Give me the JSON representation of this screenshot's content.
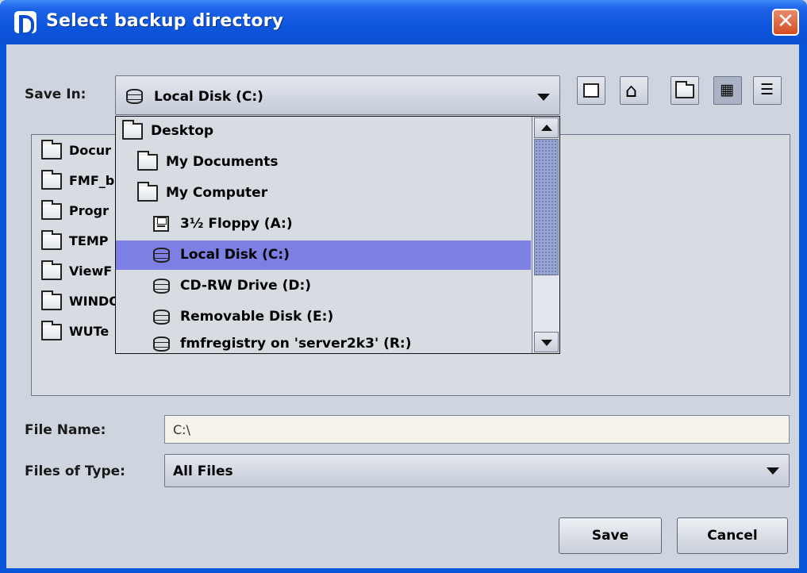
{
  "window": {
    "title": "Select backup directory"
  },
  "save_in": {
    "label": "Save In:",
    "value": "Local Disk (C:)"
  },
  "toolbar": {
    "buttons": [
      {
        "name": "up-one-level-icon"
      },
      {
        "name": "home-icon"
      },
      {
        "name": "new-folder-icon"
      },
      {
        "name": "list-view-icon",
        "active": true
      },
      {
        "name": "details-view-icon"
      }
    ]
  },
  "file_list": {
    "items": [
      "Docur",
      "FMF_b",
      "Progr",
      "TEMP",
      "ViewF",
      "WINDO",
      "WUTe"
    ]
  },
  "dropdown": {
    "items": [
      {
        "label": "Desktop",
        "icon": "folder-icon",
        "indent": 0
      },
      {
        "label": "My Documents",
        "icon": "folder-icon",
        "indent": 1
      },
      {
        "label": "My Computer",
        "icon": "folder-icon",
        "indent": 1
      },
      {
        "label": "3½ Floppy (A:)",
        "icon": "floppy-icon",
        "indent": 2
      },
      {
        "label": "Local Disk (C:)",
        "icon": "disk-icon",
        "indent": 2,
        "selected": true
      },
      {
        "label": "CD-RW Drive (D:)",
        "icon": "disk-icon",
        "indent": 2
      },
      {
        "label": "Removable Disk (E:)",
        "icon": "disk-icon",
        "indent": 2
      },
      {
        "label": "fmfregistry on 'server2k3' (R:)",
        "icon": "disk-icon",
        "indent": 2
      }
    ]
  },
  "file_name": {
    "label": "File Name:",
    "value": "C:\\"
  },
  "file_type": {
    "label": "Files of Type:",
    "value": "All Files"
  },
  "buttons": {
    "save": "Save",
    "cancel": "Cancel"
  },
  "colors": {
    "titlebar": "#0b4fd0",
    "selection": "#7d80e2",
    "panel": "#cfd5df"
  }
}
